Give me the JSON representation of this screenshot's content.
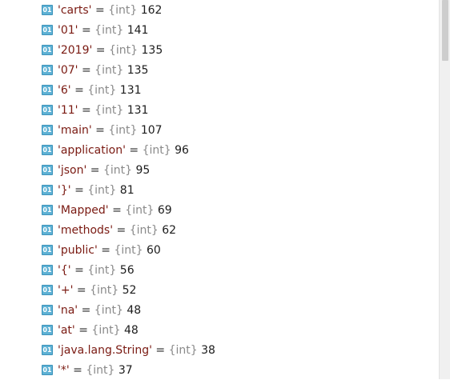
{
  "badge_text": "01",
  "type_label": "{int}",
  "equals": "=",
  "items": [
    {
      "key": "'carts'",
      "value": "162"
    },
    {
      "key": "'01'",
      "value": "141"
    },
    {
      "key": "'2019'",
      "value": "135"
    },
    {
      "key": "'07'",
      "value": "135"
    },
    {
      "key": "'6'",
      "value": "131"
    },
    {
      "key": "'11'",
      "value": "131"
    },
    {
      "key": "'main'",
      "value": "107"
    },
    {
      "key": "'application'",
      "value": "96"
    },
    {
      "key": "'json'",
      "value": "95"
    },
    {
      "key": "'}'",
      "value": "81"
    },
    {
      "key": "'Mapped'",
      "value": "69"
    },
    {
      "key": "'methods'",
      "value": "62"
    },
    {
      "key": "'public'",
      "value": "60"
    },
    {
      "key": "'{'",
      "value": "56"
    },
    {
      "key": "'+'",
      "value": "52"
    },
    {
      "key": "'na'",
      "value": "48"
    },
    {
      "key": "'at'",
      "value": "48"
    },
    {
      "key": "'java.lang.String'",
      "value": "38"
    },
    {
      "key": "'*'",
      "value": "37"
    }
  ]
}
